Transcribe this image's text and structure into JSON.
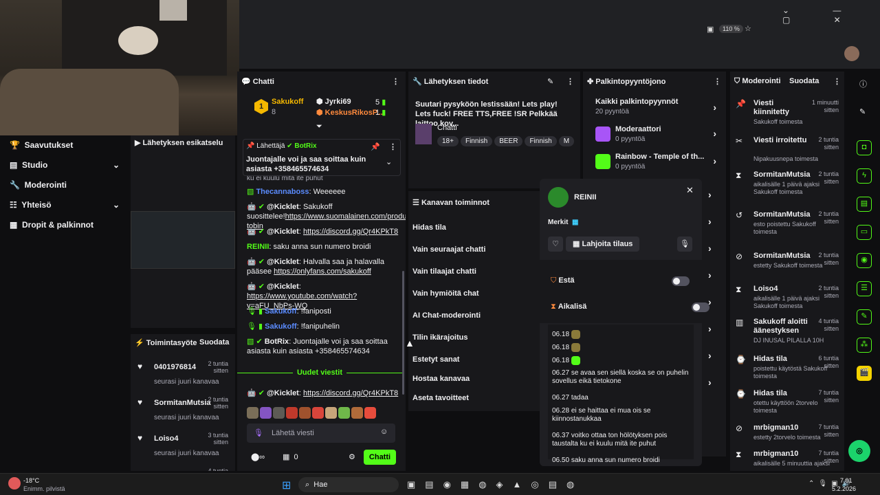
{
  "browser": {
    "zoom": "110 %"
  },
  "left_nav": {
    "items": [
      {
        "label": "Saavutukset"
      },
      {
        "label": "Studio"
      },
      {
        "label": "Moderointi"
      },
      {
        "label": "Yhteisö"
      },
      {
        "label": "Dropit & palkinnot"
      }
    ]
  },
  "preview": {
    "title": "Lähetyksen esikatselu"
  },
  "activity": {
    "title": "Toimintasyöte",
    "filter": "Suodata",
    "items": [
      {
        "name": "0401976814",
        "time": "2 tuntia sitten",
        "desc": "seurasi juuri kanavaa"
      },
      {
        "name": "SormitanMutsia",
        "time": "2 tuntia sitten",
        "desc": "seurasi juuri kanavaa"
      },
      {
        "name": "Loiso4",
        "time": "3 tuntia sitten",
        "desc": "seurasi juuri kanavaa"
      },
      {
        "name": "Denatollo",
        "time": "4 tuntia sitten",
        "desc": ""
      }
    ]
  },
  "chat": {
    "title": "Chatti",
    "leaders": [
      {
        "name": "Sakukoff",
        "count": "8"
      },
      {
        "name": "Jyrki69",
        "count": "5"
      },
      {
        "name": "KeskusRikosP...",
        "count": "1"
      }
    ],
    "pinned": {
      "label": "Lähettäjä",
      "sender": "BotRix",
      "text": "Juontajalle voi ja saa soittaa kuin asiasta +358465574634"
    },
    "cut_text": "ku ei kuulu mitä ite puhut",
    "messages": [
      {
        "user": "Thecannaboss",
        "text": "Weeeeee"
      },
      {
        "user": "@Kicklet",
        "link": "https://www.suomalainen.com/products/ella-tobin",
        "text": "Sakukoff suosittelee!"
      },
      {
        "user": "@Kicklet",
        "link": "https://discord.gg/Qr4KPkT8",
        "text": ""
      },
      {
        "user": "REINII",
        "text": "saku anna sun numero broidi"
      },
      {
        "user": "@Kicklet",
        "text": "Halvalla saa ja halavalla pääsee ",
        "link": "https://onlyfans.com/sakukoff"
      },
      {
        "user": "@Kicklet",
        "link": "https://www.youtube.com/watch?v=aFU_NbPs-WQ",
        "text": ""
      },
      {
        "user": "Sakukoff",
        "text": "!faniposti"
      },
      {
        "user": "Sakukoff",
        "text": "!fanipuhelin"
      },
      {
        "user": "BotRix",
        "text": "Juontajalle voi ja saa soittaa asiasta kuin asiasta +358465574634"
      }
    ],
    "new_msgs": "Uudet viestit",
    "last": {
      "user": "@Kicklet",
      "link": "https://discord.gg/Qr4KPkT8"
    },
    "placeholder": "Lähetä viesti",
    "count": "0",
    "send": "Chatti"
  },
  "stream_info": {
    "title": "Lähetyksen tiedot",
    "desc": "Suutari pysyköön lestissään! Lets play! Lets fuck! FREE TTS,FREE !SR Pelkkää laittoo kov...",
    "category": "Chatti",
    "tags": [
      "18+",
      "Finnish",
      "BEER",
      "Finnish",
      "M"
    ]
  },
  "channel_actions": {
    "title": "Kanavan toiminnot",
    "items": [
      "Hidas tila",
      "Vain seuraajat chatti",
      "Vain tilaajat chatti",
      "Vain hymiöitä chat",
      "AI Chat-moderointi",
      "Tilin ikärajoitus",
      "Estetyt sanat",
      "Hostaa kanavaa",
      "Aseta tavoitteet"
    ]
  },
  "rewards": {
    "title": "Palkintopyyntöjono",
    "all": "Kaikki palkintopyynnöt",
    "all_count": "20 pyyntöä",
    "items": [
      {
        "name": "Moderaattori",
        "count": "0 pyyntöä"
      },
      {
        "name": "Rainbow - Temple of th...",
        "count": "0 pyyntöä"
      }
    ]
  },
  "user_card": {
    "name": "REINII",
    "badges_label": "Merkit",
    "gift": "Lahjoita tilaus",
    "ban": "Estä",
    "timeout": "Aikalisä",
    "history": [
      {
        "t": "06.18",
        "m": ""
      },
      {
        "t": "06.18",
        "m": ""
      },
      {
        "t": "06.18",
        "m": ""
      },
      {
        "t": "06.27",
        "m": "se avaa sen siellä koska se on puhelin sovellus eikä tietokone"
      },
      {
        "t": "06.27",
        "m": "tadaa"
      },
      {
        "t": "06.28",
        "m": "ei se haittaa ei mua ois se kiinnostanukkaa"
      },
      {
        "t": "06.37",
        "m": "voitko ottaa ton hölötyksen pois taustalta ku ei kuulu mitä ite puhut"
      },
      {
        "t": "06.50",
        "m": "saku anna sun numero broidi"
      }
    ]
  },
  "moderation": {
    "title": "Moderointi",
    "filter": "Suodata",
    "items": [
      {
        "title": "Viesti kiinnitetty",
        "time": "1 minuutti sitten",
        "sub": "Sakukoff toimesta"
      },
      {
        "title": "Viesti irroitettu",
        "time": "2 tuntia sitten",
        "sub": "Nipakuusnepa toimesta"
      },
      {
        "title": "SormitanMutsia",
        "time": "2 tuntia sitten",
        "sub": "aikalisälle 1 päivä ajaksi Sakukoff toimesta"
      },
      {
        "title": "SormitanMutsia",
        "time": "2 tuntia sitten",
        "sub": "esto poistettu Sakukoff toimesta"
      },
      {
        "title": "SormitanMutsia",
        "time": "2 tuntia sitten",
        "sub": "estetty Sakukoff toimesta"
      },
      {
        "title": "Loiso4",
        "time": "2 tuntia sitten",
        "sub": "aikalisälle 1 päivä ajaksi Sakukoff toimesta"
      },
      {
        "title": "Sakukoff aloitti äänestyksen",
        "time": "4 tuntia sitten",
        "sub": "DJ INUSAL PILALLA 10H"
      },
      {
        "title": "Hidas tila",
        "time": "6 tuntia sitten",
        "sub": "poistettu käytöstä Sakukoff toimesta"
      },
      {
        "title": "Hidas tila",
        "time": "7 tuntia sitten",
        "sub": "otettu käyttöön 2torvelo toimesta"
      },
      {
        "title": "mrbigman10",
        "time": "7 tuntia sitten",
        "sub": "estetty 2torvelo toimesta"
      },
      {
        "title": "mrbigman10",
        "time": "7 tuntia sitten",
        "sub": "aikalisälle 5 minuuttia ajaksi"
      }
    ]
  },
  "taskbar": {
    "temp": "-18°C",
    "weather": "Enimm. pilvistä",
    "search": "Hae",
    "time": "7.01",
    "date": "5.2.2026"
  }
}
